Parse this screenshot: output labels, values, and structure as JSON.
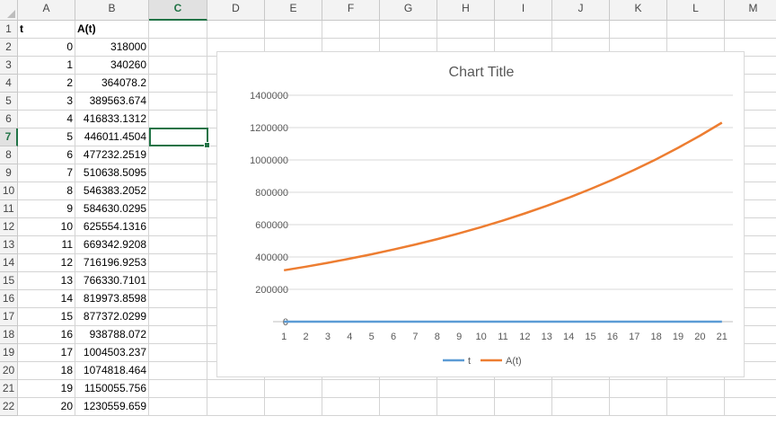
{
  "spreadsheet": {
    "columns": [
      "A",
      "B",
      "C",
      "D",
      "E",
      "F",
      "G",
      "H",
      "I",
      "J",
      "K",
      "L",
      "M"
    ],
    "selected_column": "C",
    "selected_row": 7,
    "row_count": 22,
    "header_row": [
      "t",
      "A(t)"
    ],
    "rows": [
      [
        "0",
        "318000"
      ],
      [
        "1",
        "340260"
      ],
      [
        "2",
        "364078.2"
      ],
      [
        "3",
        "389563.674"
      ],
      [
        "4",
        "416833.1312"
      ],
      [
        "5",
        "446011.4504"
      ],
      [
        "6",
        "477232.2519"
      ],
      [
        "7",
        "510638.5095"
      ],
      [
        "8",
        "546383.2052"
      ],
      [
        "9",
        "584630.0295"
      ],
      [
        "10",
        "625554.1316"
      ],
      [
        "11",
        "669342.9208"
      ],
      [
        "12",
        "716196.9253"
      ],
      [
        "13",
        "766330.7101"
      ],
      [
        "14",
        "819973.8598"
      ],
      [
        "15",
        "877372.0299"
      ],
      [
        "16",
        "938788.072"
      ],
      [
        "17",
        "1004503.237"
      ],
      [
        "18",
        "1074818.464"
      ],
      [
        "19",
        "1150055.756"
      ],
      [
        "20",
        "1230559.659"
      ]
    ]
  },
  "chart_data": {
    "type": "line",
    "title": "Chart Title",
    "categories": [
      "1",
      "2",
      "3",
      "4",
      "5",
      "6",
      "7",
      "8",
      "9",
      "10",
      "11",
      "12",
      "13",
      "14",
      "15",
      "16",
      "17",
      "18",
      "19",
      "20",
      "21"
    ],
    "yticks": [
      "0",
      "200000",
      "400000",
      "600000",
      "800000",
      "1000000",
      "1200000",
      "1400000"
    ],
    "ylim": [
      0,
      1400000
    ],
    "grid": true,
    "legend": "bottom",
    "series": [
      {
        "name": "t",
        "color": "#5b9bd5",
        "values": [
          0,
          1,
          2,
          3,
          4,
          5,
          6,
          7,
          8,
          9,
          10,
          11,
          12,
          13,
          14,
          15,
          16,
          17,
          18,
          19,
          20
        ]
      },
      {
        "name": "A(t)",
        "color": "#ed7d31",
        "values": [
          318000,
          340260,
          364078.2,
          389563.674,
          416833.1312,
          446011.4504,
          477232.2519,
          510638.5095,
          546383.2052,
          584630.0295,
          625554.1316,
          669342.9208,
          716196.9253,
          766330.7101,
          819973.8598,
          877372.0299,
          938788.072,
          1004503.237,
          1074818.464,
          1150055.756,
          1230559.659
        ]
      }
    ]
  }
}
